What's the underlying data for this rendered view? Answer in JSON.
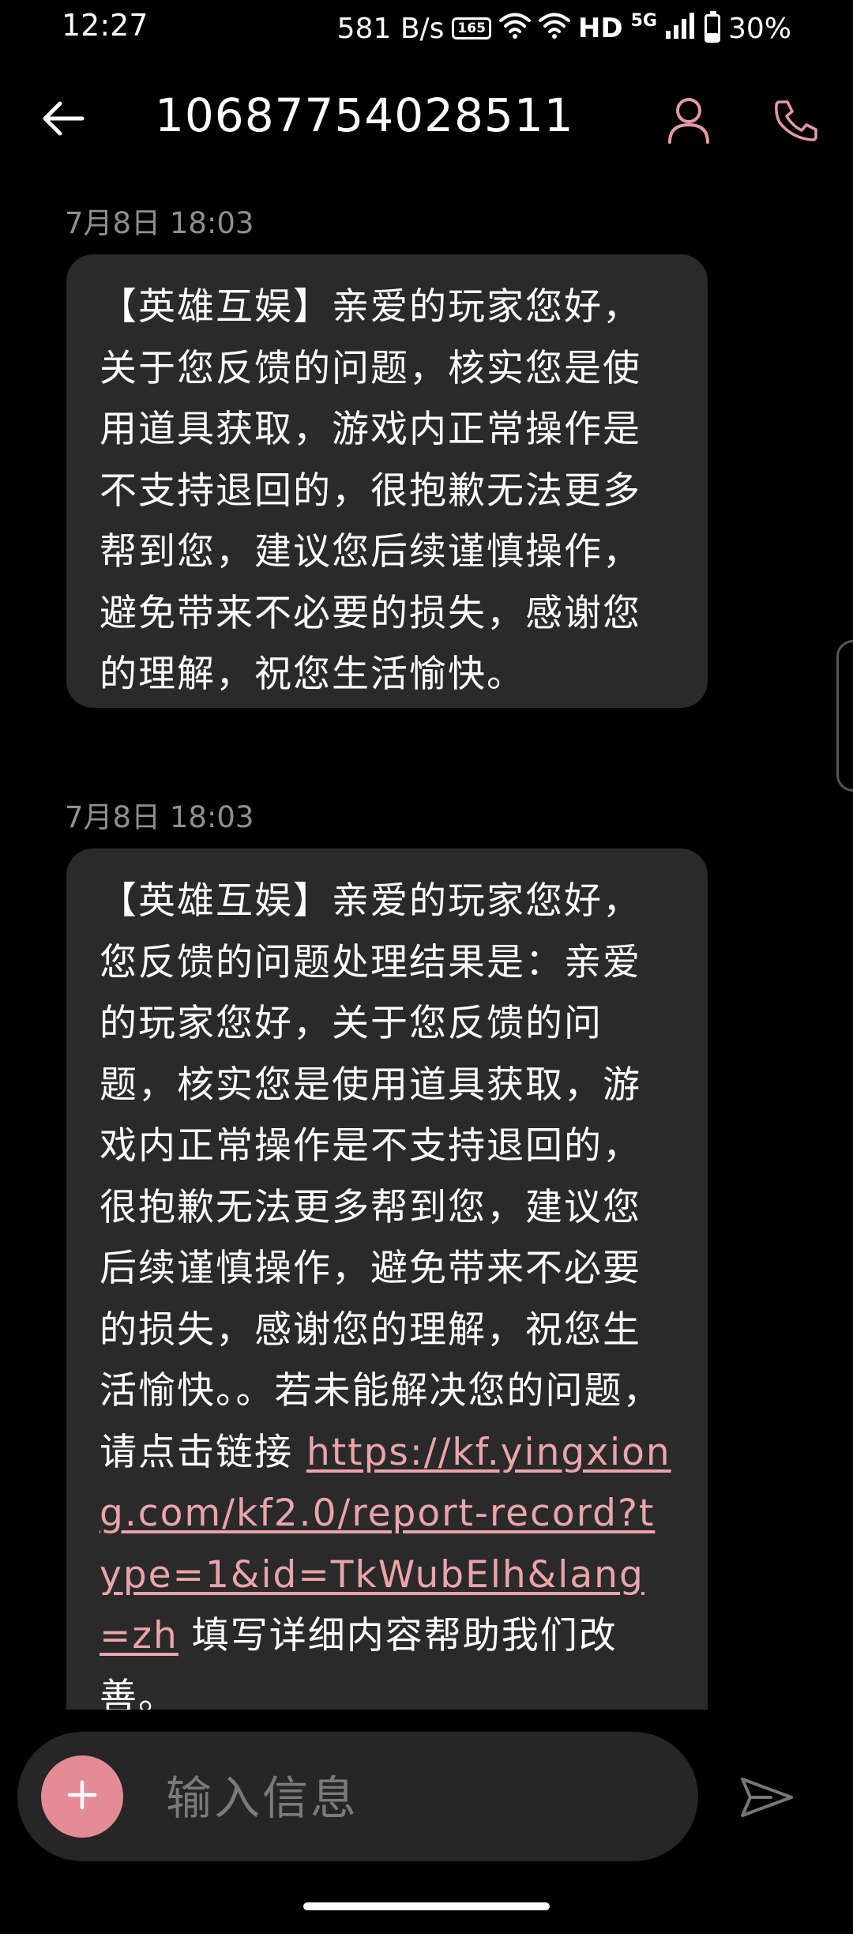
{
  "status_bar": {
    "time": "12:27",
    "net_speed": "581 B/s",
    "refresh_badge": "165",
    "hd": "HD",
    "network": "5G",
    "battery_text": "30%",
    "battery_level": 0.3
  },
  "header": {
    "title": "10687754028511",
    "back_icon": "arrow-left-icon",
    "contact_icon": "person-icon",
    "call_icon": "phone-icon",
    "accent_color": "#e39aa0"
  },
  "messages": [
    {
      "timestamp": "7月8日 18:03",
      "text": "【英雄互娱】亲爱的玩家您好，关于您反馈的问题，核实您是使用道具获取，游戏内正常操作是不支持退回的，很抱歉无法更多帮到您，建议您后续谨慎操作，避免带来不必要的损失，感谢您的理解，祝您生活愉快。"
    },
    {
      "timestamp": "7月8日 18:03",
      "text_before_link": "【英雄互娱】亲爱的玩家您好，您反馈的问题处理结果是：亲爱的玩家您好，关于您反馈的问题，核实您是使用道具获取，游戏内正常操作是不支持退回的，很抱歉无法更多帮到您，建议您后续谨慎操作，避免带来不必要的损失，感谢您的理解，祝您生活愉快。。若未能解决您的问题，请点击链接 ",
      "link": "https://kf.yingxiong.com/kf2.0/report-record?type=1&id=TkWubElh&lang=zh",
      "text_after_link": " 填写详细内容帮助我们改善。"
    }
  ],
  "composer": {
    "placeholder": "输入信息",
    "add_icon": "plus-icon",
    "send_icon": "send-icon",
    "add_color": "#e38c95"
  }
}
